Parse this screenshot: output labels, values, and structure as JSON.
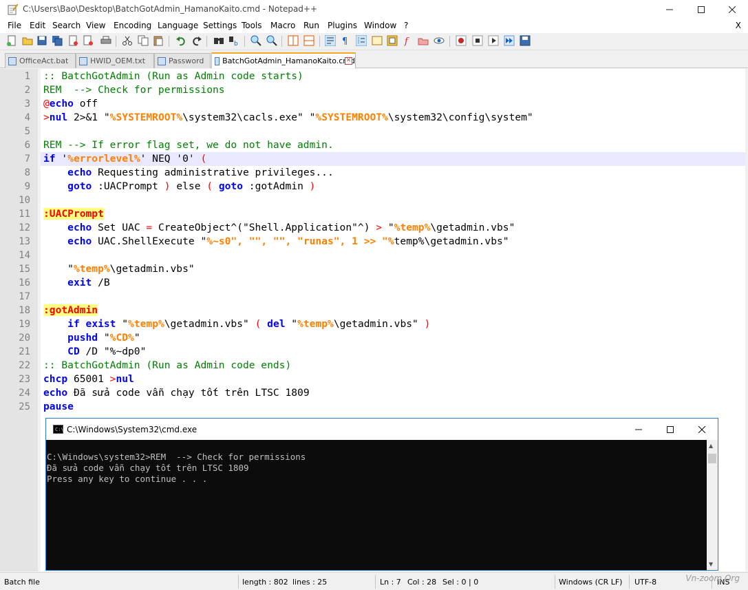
{
  "window": {
    "title": "C:\\Users\\Bao\\Desktop\\BatchGotAdmin_HamanoKaito.cmd - Notepad++"
  },
  "menu": {
    "items": [
      "File",
      "Edit",
      "Search",
      "View",
      "Encoding",
      "Language",
      "Settings",
      "Tools",
      "Macro",
      "Run",
      "Plugins",
      "Window",
      "?"
    ],
    "close_x": "X"
  },
  "tabs": [
    {
      "label": "OfficeAct.bat"
    },
    {
      "label": "HWID_OEM.txt"
    },
    {
      "label": "Password"
    },
    {
      "label": "BatchGotAdmin_HamanoKaito.cmd"
    }
  ],
  "editor": {
    "line_numbers": [
      "1",
      "2",
      "3",
      "4",
      "5",
      "6",
      "7",
      "8",
      "9",
      "10",
      "11",
      "12",
      "13",
      "14",
      "15",
      "16",
      "17",
      "18",
      "19",
      "20",
      "21",
      "22",
      "23",
      "24",
      "25"
    ],
    "lines": [
      ":: BatchGotAdmin (Run as Admin code starts)",
      "REM  --> Check for permissions",
      "@echo off",
      ">nul 2>&1 \"%SYSTEMROOT%\\system32\\cacls.exe\" \"%SYSTEMROOT%\\system32\\config\\system\"",
      "",
      "REM --> If error flag set, we do not have admin.",
      "if '%errorlevel%' NEQ '0' (",
      "    echo Requesting administrative privileges...",
      "    goto :UACPrompt ) else ( goto :gotAdmin )",
      "",
      ":UACPrompt",
      "    echo Set UAC = CreateObject^(\"Shell.Application\"^) > \"%temp%\\getadmin.vbs\"",
      "    echo UAC.ShellExecute \"%~s0\", \"\", \"\", \"runas\", 1 >> \"%temp%\\getadmin.vbs\"",
      "",
      "    \"%temp%\\getadmin.vbs\"",
      "    exit /B",
      "",
      ":gotAdmin",
      "    if exist \"%temp%\\getadmin.vbs\" ( del \"%temp%\\getadmin.vbs\" )",
      "    pushd \"%CD%\"",
      "    CD /D \"%~dp0\"",
      ":: BatchGotAdmin (Run as Admin code ends)",
      "chcp 65001 >nul",
      "echo Đã sửa code vẫn chạy tốt trên LTSC 1809",
      "pause"
    ]
  },
  "cmd": {
    "title": "C:\\Windows\\System32\\cmd.exe",
    "icon_text": "C:\\",
    "output": [
      "C:\\Windows\\system32>REM  --> Check for permissions",
      "Đã sửa code vẫn chạy tốt trên LTSC 1809",
      "Press any key to continue . . ."
    ]
  },
  "status": {
    "file_type": "Batch file",
    "length": "length : 802",
    "lines": "lines : 25",
    "ln": "Ln : 7",
    "col": "Col : 28",
    "sel": "Sel : 0 | 0",
    "eol": "Windows (CR LF)",
    "encoding": "UTF-8",
    "mode": "INS",
    "watermark": "Vn-zoom.Org"
  },
  "colors": {
    "comment": "#008000",
    "keyword": "#0000ff",
    "operator": "#ff0000",
    "variable": "#ff8000",
    "label_bg": "#ffff80",
    "current_line": "#e8e8ff"
  }
}
